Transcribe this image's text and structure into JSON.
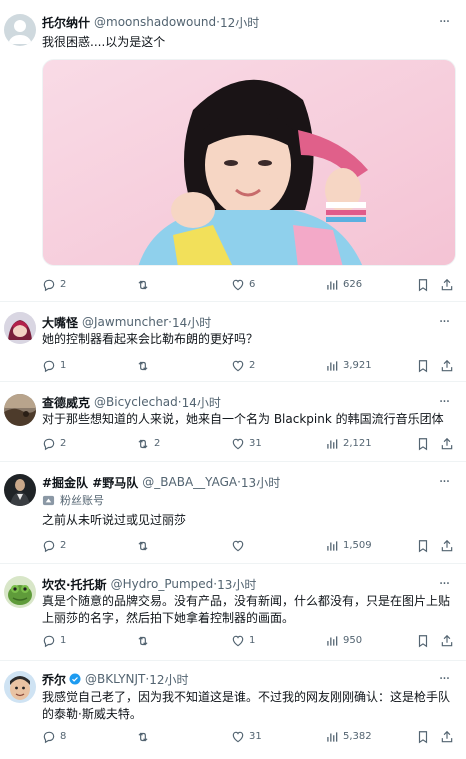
{
  "tweets": [
    {
      "name": "托尔纳什",
      "handle": "@moonshadowound",
      "time": "12小时",
      "text": "我很困惑....以为是这个",
      "reply": "2",
      "retweet": "",
      "like": "6",
      "views": "626"
    },
    {
      "name": "大嘴怪",
      "handle": "@Jawmuncher",
      "time": "14小时",
      "text": "她的控制器看起来会比勒布朗的更好吗？",
      "reply": "1",
      "retweet": "",
      "like": "2",
      "views": "3,921"
    },
    {
      "name": "查德威克",
      "handle": "@Bicyclechad",
      "time": "14小时",
      "text": "对于那些想知道的人来说，她来自一个名为 Blackpink 的韩国流行音乐团体",
      "reply": "2",
      "retweet": "2",
      "like": "31",
      "views": "2,121"
    },
    {
      "name": "#掘金队 #野马队",
      "handle": "@_BABA__YAGA",
      "time": "13小时",
      "subtitle": "粉丝账号",
      "text": "之前从未听说过或见过丽莎",
      "reply": "2",
      "retweet": "",
      "like": "",
      "views": "1,509"
    },
    {
      "name": "坎农·托托斯",
      "handle": "@Hydro_Pumped",
      "time": "13小时",
      "text": "真是个随意的品牌交易。没有产品，没有新闻，什么都没有，只是在图片上贴上丽莎的名字，然后拍下她拿着控制器的画面。",
      "reply": "1",
      "retweet": "",
      "like": "1",
      "views": "950"
    },
    {
      "name": "乔尔",
      "handle": "@BKLYNJT",
      "time": "12小时",
      "text": "我感觉自己老了，因为我不知道这是谁。不过我的网友刚刚确认：这是枪手队的泰勒·斯威夫特。",
      "reply": "8",
      "retweet": "",
      "like": "31",
      "views": "5,382"
    }
  ],
  "separator": " · ",
  "more_glyph": "···",
  "colors": {
    "secondary": "#536471",
    "verified": "#1d9bf0",
    "border": "#eff3f4"
  }
}
